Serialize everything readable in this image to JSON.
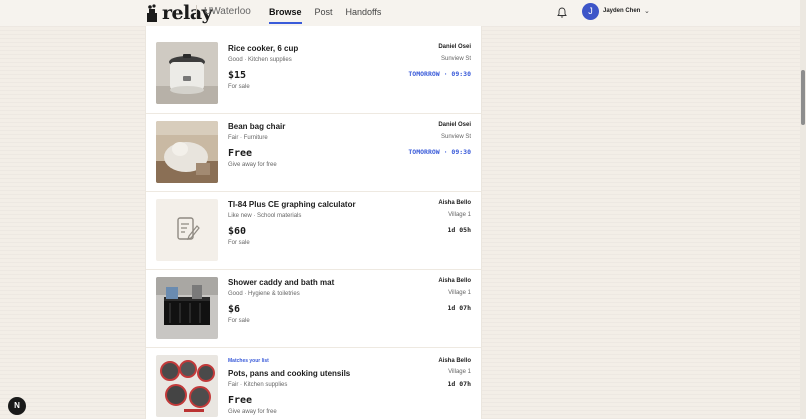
{
  "header": {
    "logo_text": "relay",
    "org": "UWaterloo",
    "nav": [
      "Browse",
      "Post",
      "Handoffs"
    ],
    "user_initial": "J",
    "user_name": "Jayden Chen"
  },
  "listings": [
    {
      "title": "Rice cooker, 6 cup",
      "condition": "Good · Kitchen supplies",
      "price": "$15",
      "type": "For sale",
      "seller": "Daniel Osei",
      "location": "Sunview St",
      "time": "TOMORROW · 09:30",
      "match": ""
    },
    {
      "title": "Bean bag chair",
      "condition": "Fair · Furniture",
      "price": "Free",
      "type": "Give away for free",
      "seller": "Daniel Osei",
      "location": "Sunview St",
      "time": "TOMORROW · 09:30",
      "match": ""
    },
    {
      "title": "TI-84 Plus CE graphing calculator",
      "condition": "Like new · School materials",
      "price": "$60",
      "type": "For sale",
      "seller": "Aisha Bello",
      "location": "Village 1",
      "time": "1d 05h",
      "match": ""
    },
    {
      "title": "Shower caddy and bath mat",
      "condition": "Good · Hygiene & toiletries",
      "price": "$6",
      "type": "For sale",
      "seller": "Aisha Bello",
      "location": "Village 1",
      "time": "1d 07h",
      "match": ""
    },
    {
      "title": "Pots, pans and cooking utensils",
      "condition": "Fair · Kitchen supplies",
      "price": "Free",
      "type": "Give away for free",
      "seller": "Aisha Bello",
      "location": "Village 1",
      "time": "1d 07h",
      "match": "Matches your list"
    }
  ],
  "badge": "N",
  "colors": {
    "accent": "#3a5bd9",
    "background": "#f3eee7",
    "avatar": "#3d55c8"
  }
}
